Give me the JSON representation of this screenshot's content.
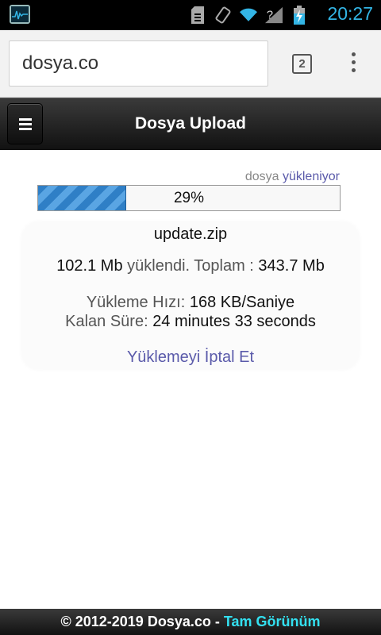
{
  "statusbar": {
    "time": "20:27",
    "icons": [
      "activity-icon",
      "sim-card-icon",
      "rotation-icon",
      "wifi-icon",
      "no-signal-icon",
      "battery-charging-icon"
    ],
    "accent_color": "#33b5e5"
  },
  "browser": {
    "url": "dosya.co",
    "tab_count": "2",
    "menu_icon": "overflow-menu-icon"
  },
  "header": {
    "title": "Dosya Upload",
    "menu_icon": "hamburger-icon"
  },
  "upload": {
    "status_word": "dosya",
    "status_word2": "yükleniyor",
    "progress_percent": 29,
    "progress_label": "29%",
    "filename": "update.zip",
    "uploaded": "102.1 Mb",
    "uploaded_label": " yüklendi. Toplam : ",
    "total": "343.7 Mb",
    "speed_label": "Yükleme Hızı: ",
    "speed_value": "168 KB/Saniye",
    "remaining_label": "Kalan Süre: ",
    "remaining_value": "24 minutes 33 seconds",
    "cancel_label": "Yüklemeyi İptal Et",
    "accent_color": "#5a5aaa"
  },
  "footer": {
    "copyright": "© 2012-2019 Dosya.co",
    "separator": " - ",
    "full_view": "Tam Görünüm"
  }
}
